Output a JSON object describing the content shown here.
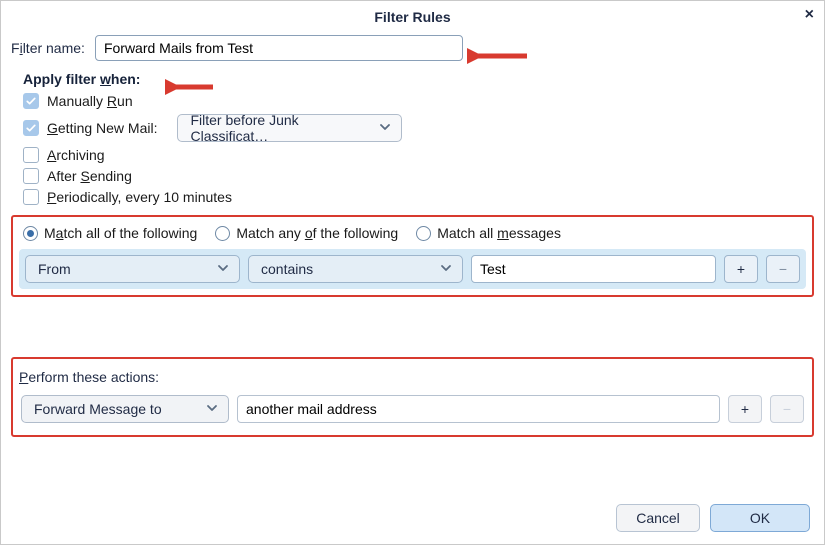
{
  "dialog": {
    "title": "Filter Rules",
    "close_icon": "×"
  },
  "filter_name": {
    "label_pre": "F",
    "label_u": "i",
    "label_post": "lter name:",
    "value": "Forward Mails from Test"
  },
  "apply_when": {
    "header_pre": "Apply filter ",
    "header_u": "w",
    "header_post": "hen:",
    "items": {
      "manual": {
        "checked": true,
        "pre": "Manually ",
        "u": "R",
        "post": "un"
      },
      "newmail": {
        "checked": true,
        "u": "G",
        "post": "etting New Mail:",
        "select_label": "Filter before Junk Classificat…"
      },
      "archiving": {
        "checked": false,
        "u": "A",
        "post": "rchiving"
      },
      "aftersend": {
        "checked": false,
        "pre": "After ",
        "u": "S",
        "post": "ending"
      },
      "periodic": {
        "checked": false,
        "u": "P",
        "post": "eriodically, every 10 minutes"
      }
    }
  },
  "match": {
    "all": {
      "selected": true,
      "pre": "M",
      "u": "a",
      "post": "tch all of the following"
    },
    "any": {
      "selected": false,
      "pre": "Match any ",
      "u": "o",
      "post": "f the following"
    },
    "msgs": {
      "selected": false,
      "pre": "Match all ",
      "u": "m",
      "post": "essages"
    }
  },
  "condition": {
    "field": "From",
    "op": "contains",
    "value": "Test",
    "plus": "+",
    "minus": "−"
  },
  "actions_section": {
    "label_u": "P",
    "label_post": "erform these actions:"
  },
  "action": {
    "type": "Forward Message to",
    "value": "another mail address",
    "plus": "+",
    "minus": "−"
  },
  "footer": {
    "cancel": "Cancel",
    "ok": "OK"
  },
  "colors": {
    "arrow": "#d83a2f"
  }
}
